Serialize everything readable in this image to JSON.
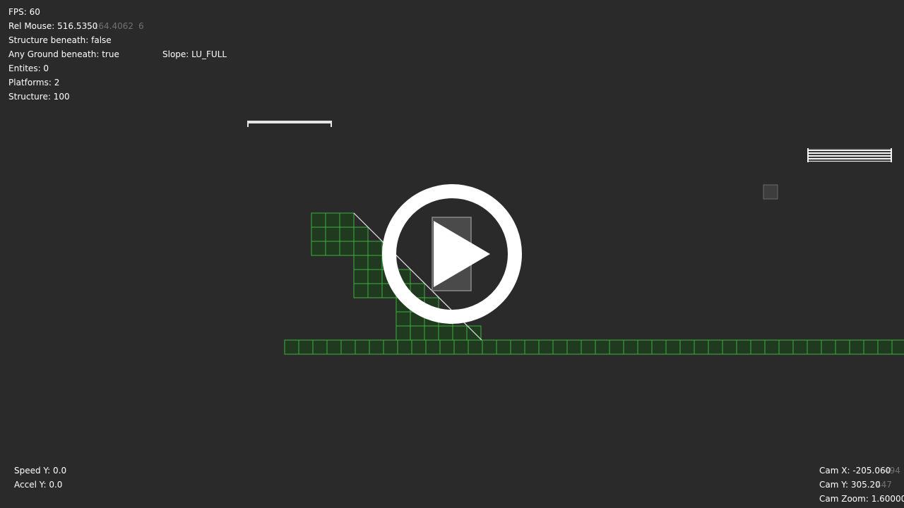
{
  "hud": {
    "fps": "FPS: 60",
    "rel_mouse": "Rel Mouse: 516.5350",
    "rel_mouse_ghost": "3,-164.4062",
    "rel_mouse_ghost2": "6",
    "structure_beneath": "Structure beneath: false",
    "any_ground_beneath": "Any Ground beneath: true",
    "slope": "Slope: LU_FULL",
    "entities": "Entites: 0",
    "platforms": "Platforms: 2",
    "structure": "Structure: 100"
  },
  "physics": {
    "speed_y": "Speed Y: 0.0",
    "accel_y": "Accel Y: 0.0"
  },
  "camera": {
    "cam_x": "Cam X: -205.060",
    "cam_x_ghost": "494",
    "cam_y": "Cam Y: 305.20",
    "cam_y_ghost": "447",
    "cam_zoom": "Cam Zoom: 1.60000"
  },
  "colors": {
    "background": "#2a2a2a",
    "tile_fill": "#1f3a1f",
    "tile_stroke": "#3fae3f",
    "platform": "#e6e6e6",
    "overlay": "#ffffff"
  },
  "overlay": {
    "icon": "play-icon"
  }
}
